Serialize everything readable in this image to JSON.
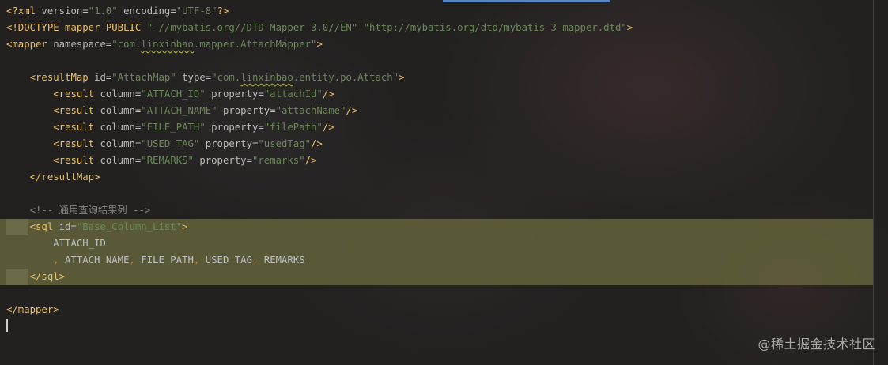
{
  "editor": {
    "accent_color": "#5b84c4",
    "line_highlight_color": "#69693e"
  },
  "code": {
    "l1": {
      "tag": "<?xml",
      "a1": " version",
      "v1": "\"1.0\"",
      "a2": " encoding",
      "v2": "\"UTF-8\"",
      "close": "?>"
    },
    "l2": {
      "tag": "<!DOCTYPE",
      "rest": " mapper PUBLIC ",
      "v1": "\"-//mybatis.org//DTD Mapper 3.0//EN\"",
      "v2": "\"http://mybatis.org/dtd/mybatis-3-mapper.dtd\"",
      "close": ">"
    },
    "l3": {
      "tag": "<mapper",
      "a1": " namespace",
      "vq1": "\"com.",
      "vsq": "linxinbao",
      "vq2": ".mapper.AttachMapper\"",
      "close": ">"
    },
    "l5": {
      "indent": "    ",
      "tag": "<resultMap",
      "a1": " id",
      "v1": "\"AttachMap\"",
      "a2": " type",
      "vq1": "\"com.",
      "vsq": "linxinbao",
      "vq2": ".entity.po.Attach\"",
      "close": ">"
    },
    "results": [
      {
        "indent": "        ",
        "tag": "<result",
        "a1": " column",
        "v1": "\"ATTACH_ID\"",
        "a2": " property",
        "v2": "\"attachId\"",
        "close": "/>"
      },
      {
        "indent": "        ",
        "tag": "<result",
        "a1": " column",
        "v1": "\"ATTACH_NAME\"",
        "a2": " property",
        "v2": "\"attachName\"",
        "close": "/>"
      },
      {
        "indent": "        ",
        "tag": "<result",
        "a1": " column",
        "v1": "\"FILE_PATH\"",
        "a2": " property",
        "v2": "\"filePath\"",
        "close": "/>"
      },
      {
        "indent": "        ",
        "tag": "<result",
        "a1": " column",
        "v1": "\"USED_TAG\"",
        "a2": " property",
        "v2": "\"usedTag\"",
        "close": "/>"
      },
      {
        "indent": "        ",
        "tag": "<result",
        "a1": " column",
        "v1": "\"REMARKS\"",
        "a2": " property",
        "v2": "\"remarks\"",
        "close": "/>"
      }
    ],
    "l11": {
      "indent": "    ",
      "tag": "</resultMap",
      "close": ">"
    },
    "l13": {
      "indent": "    ",
      "comment": "<!-- 通用查询结果列 -->"
    },
    "l14": {
      "tag": "<sql",
      "a1": " id",
      "v1": "\"Base_Column_List\"",
      "close": ">"
    },
    "l15": {
      "indent": "        ",
      "text": "ATTACH_ID"
    },
    "l16": {
      "indent": "        ",
      "c1": ",",
      "t1": " ATTACH_NAME",
      "c2": ",",
      "t2": " FILE_PATH",
      "c3": ",",
      "t3": " USED_TAG",
      "c4": ",",
      "t4": " REMARKS"
    },
    "l17": {
      "tag": "</sql",
      "close": ">"
    },
    "l19": {
      "tag": "</mapper",
      "close": ">"
    }
  },
  "watermark": "@稀土掘金技术社区",
  "eq": "="
}
